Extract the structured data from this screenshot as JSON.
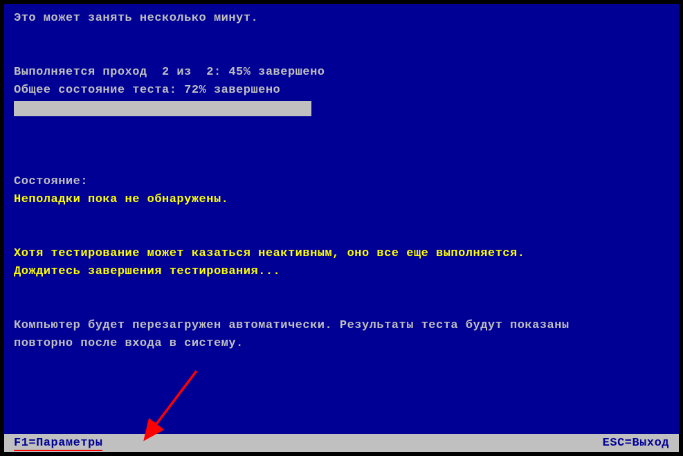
{
  "body": {
    "wait_message": "Это может занять несколько минут.",
    "pass_progress": "Выполняется проход  2 из  2: 45% завершено",
    "overall_status": "Общее состояние теста: 72% завершено",
    "status_label": "Состояние:",
    "no_problems": "Неполадки пока не обнаружены.",
    "inactive_warning": "Хотя тестирование может казаться неактивным, оно все еще выполняется.",
    "wait_completion": "Дождитесь завершения тестирования...",
    "restart_info": "Компьютер будет перезагружен автоматически. Результаты теста будут показаны",
    "restart_info2": "повторно после входа в систему."
  },
  "footer": {
    "f1_label": "F1=Параметры",
    "esc_label": "ESC=Выход"
  }
}
